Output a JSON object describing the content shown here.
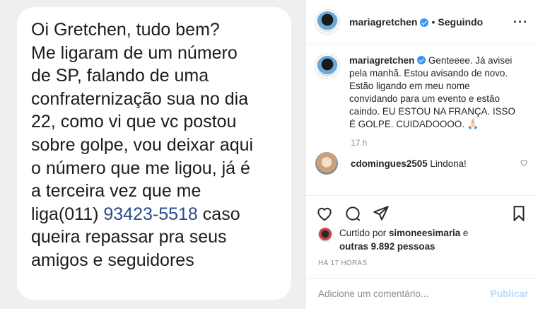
{
  "message": {
    "lines": [
      "Oi Gretchen, tudo bem?",
      "Me ligaram de um número",
      "de SP, falando de uma",
      "confraternização sua no dia",
      "22, como vi que vc postou",
      "sobre golpe, vou deixar aqui",
      "o número que me ligou, já é",
      "a terceira vez que me"
    ],
    "phone_prefix": "liga(011) ",
    "phone_number": "93423-5518",
    "phone_suffix": " caso",
    "tail_lines": [
      "queira repassar pra seus",
      "amigos e seguidores"
    ]
  },
  "header": {
    "username": "mariagretchen",
    "dot": "•",
    "following": "Seguindo",
    "more": "···"
  },
  "caption": {
    "username": "mariagretchen",
    "text": " Genteeee. Já avisei pela manhã. Estou avisando de novo. Estão ligando em meu nome convidando para um evento e estão caindo. EU ESTOU NA FRANÇA. ISSO É GOLPE. CUIDADOOOO. 🙏🏻",
    "time": "17 h"
  },
  "comment": {
    "username": "cdomingues2505",
    "text": " Lindona!"
  },
  "likes": {
    "prefix": "Curtido por ",
    "user": "simoneesimaria",
    "middle": " e",
    "others": "outras 9.892 pessoas"
  },
  "posted_ago": "HÁ 17 HORAS",
  "add_comment": {
    "placeholder": "Adicione um comentário...",
    "post_label": "Publicar"
  },
  "colors": {
    "verified": "#3897f0",
    "phone": "#2b4d86",
    "post_disabled": "#b3dbff"
  }
}
